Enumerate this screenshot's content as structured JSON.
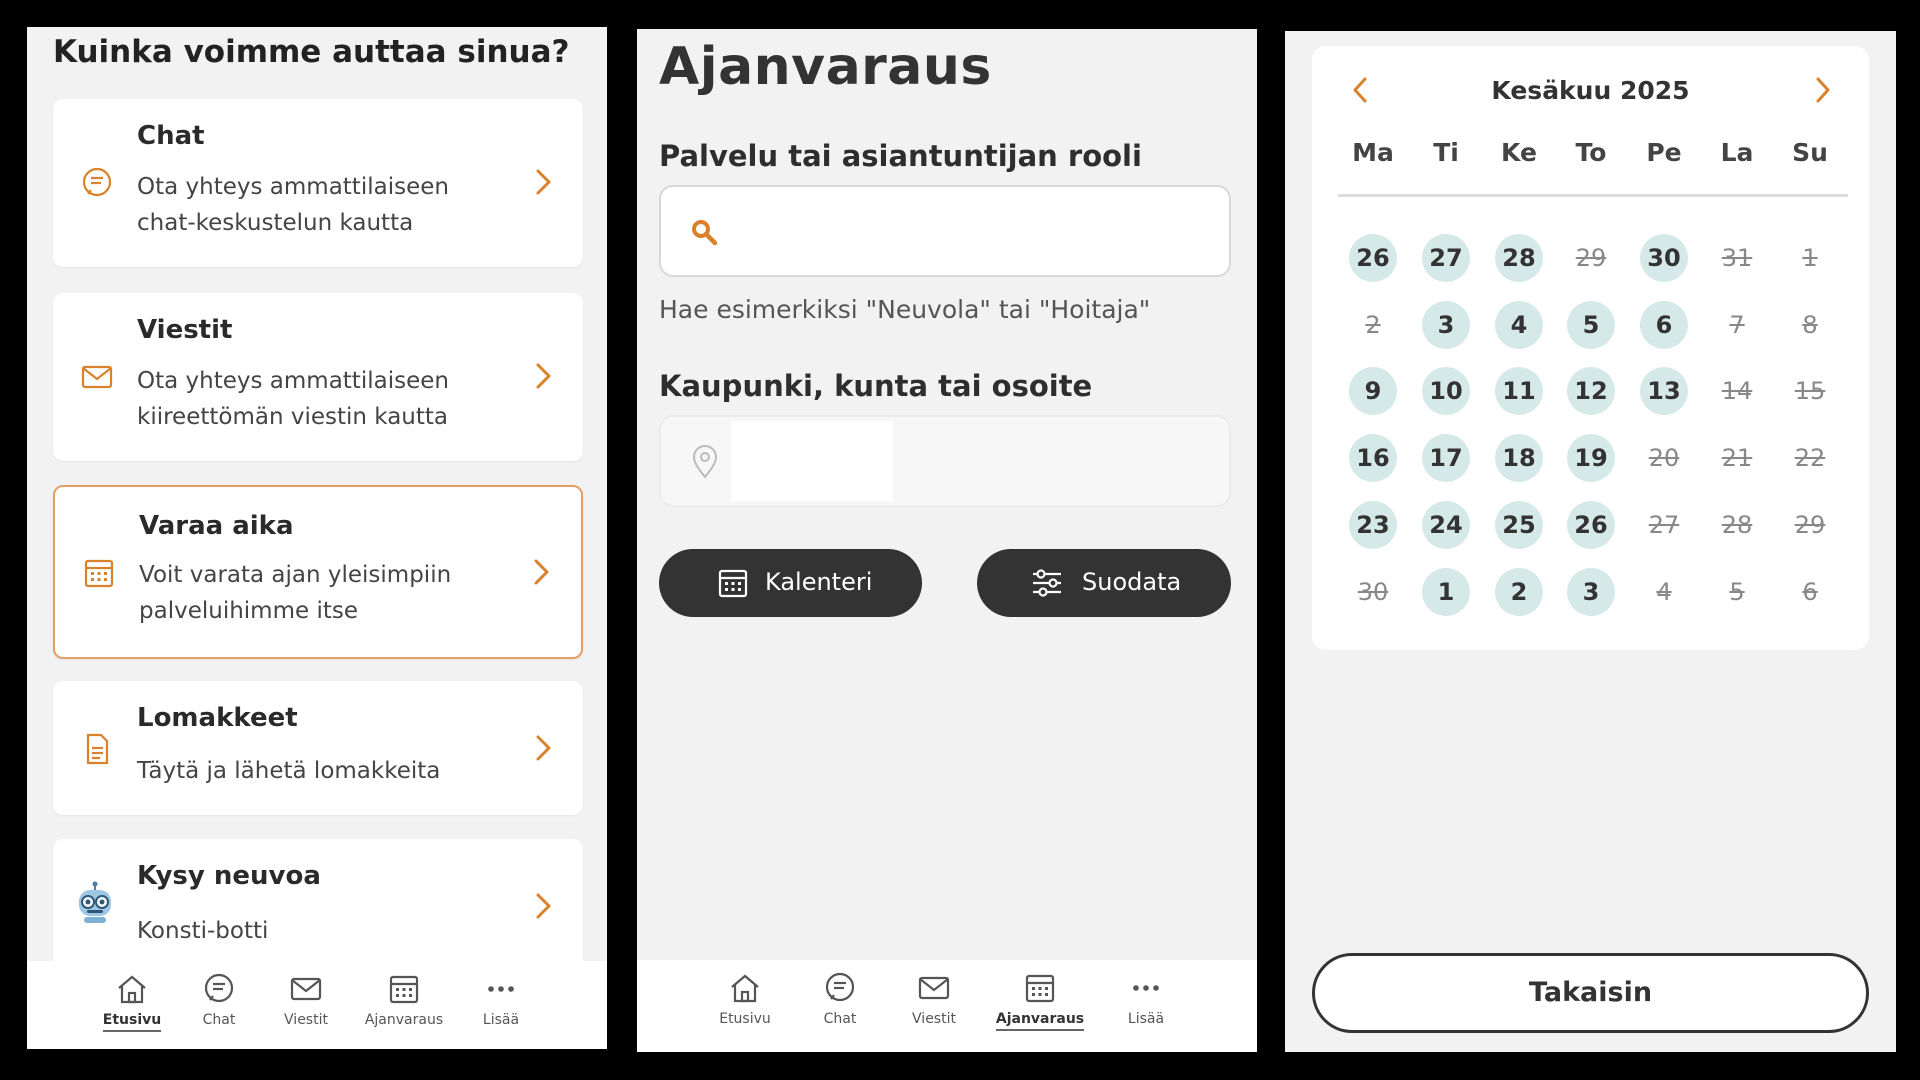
{
  "home": {
    "title": "Kuinka voimme auttaa sinua?",
    "cards": [
      {
        "title": "Chat",
        "desc": "Ota yhteys ammattilaiseen chat-keskustelun kautta",
        "icon": "chat-icon"
      },
      {
        "title": "Viestit",
        "desc": "Ota yhteys ammattilaiseen kiireettömän viestin kautta",
        "icon": "mail-icon"
      },
      {
        "title": "Varaa aika",
        "desc": "Voit varata ajan yleisimpiin palveluihimme itse",
        "icon": "calendar-icon"
      },
      {
        "title": "Lomakkeet",
        "desc": "Täytä ja lähetä lomakkeita",
        "icon": "document-icon"
      },
      {
        "title": "Kysy neuvoa",
        "desc": "Konsti-botti",
        "icon": "robot-icon"
      }
    ]
  },
  "nav": {
    "items": [
      {
        "label": "Etusivu",
        "icon": "home-icon"
      },
      {
        "label": "Chat",
        "icon": "chat-icon"
      },
      {
        "label": "Viestit",
        "icon": "mail-icon"
      },
      {
        "label": "Ajanvaraus",
        "icon": "calendar-icon"
      },
      {
        "label": "Lisää",
        "icon": "more-icon"
      }
    ]
  },
  "booking": {
    "title": "Ajanvaraus",
    "service_label": "Palvelu tai asiantuntijan rooli",
    "service_value": "",
    "hint": "Hae esimerkiksi \"Neuvola\" tai \"Hoitaja\"",
    "location_label": "Kaupunki, kunta tai osoite",
    "calendar_button": "Kalenteri",
    "filter_button": "Suodata"
  },
  "calendar": {
    "month": "Kesäkuu 2025",
    "weekdays": [
      "Ma",
      "Ti",
      "Ke",
      "To",
      "Pe",
      "La",
      "Su"
    ],
    "weeks": [
      [
        {
          "d": "26",
          "a": true
        },
        {
          "d": "27",
          "a": true
        },
        {
          "d": "28",
          "a": true
        },
        {
          "d": "29",
          "a": false
        },
        {
          "d": "30",
          "a": true
        },
        {
          "d": "31",
          "a": false
        },
        {
          "d": "1",
          "a": false
        }
      ],
      [
        {
          "d": "2",
          "a": false
        },
        {
          "d": "3",
          "a": true
        },
        {
          "d": "4",
          "a": true
        },
        {
          "d": "5",
          "a": true
        },
        {
          "d": "6",
          "a": true
        },
        {
          "d": "7",
          "a": false
        },
        {
          "d": "8",
          "a": false
        }
      ],
      [
        {
          "d": "9",
          "a": true
        },
        {
          "d": "10",
          "a": true
        },
        {
          "d": "11",
          "a": true
        },
        {
          "d": "12",
          "a": true
        },
        {
          "d": "13",
          "a": true
        },
        {
          "d": "14",
          "a": false
        },
        {
          "d": "15",
          "a": false
        }
      ],
      [
        {
          "d": "16",
          "a": true
        },
        {
          "d": "17",
          "a": true
        },
        {
          "d": "18",
          "a": true
        },
        {
          "d": "19",
          "a": true
        },
        {
          "d": "20",
          "a": false
        },
        {
          "d": "21",
          "a": false
        },
        {
          "d": "22",
          "a": false
        }
      ],
      [
        {
          "d": "23",
          "a": true
        },
        {
          "d": "24",
          "a": true
        },
        {
          "d": "25",
          "a": true
        },
        {
          "d": "26",
          "a": true
        },
        {
          "d": "27",
          "a": false
        },
        {
          "d": "28",
          "a": false
        },
        {
          "d": "29",
          "a": false
        }
      ],
      [
        {
          "d": "30",
          "a": false
        },
        {
          "d": "1",
          "a": true
        },
        {
          "d": "2",
          "a": true
        },
        {
          "d": "3",
          "a": true
        },
        {
          "d": "4",
          "a": false
        },
        {
          "d": "5",
          "a": false
        },
        {
          "d": "6",
          "a": false
        }
      ]
    ],
    "back_button": "Takaisin"
  },
  "colors": {
    "accent": "#d9822b",
    "available_day": "#d5e9e8",
    "dark_button": "#333333"
  }
}
